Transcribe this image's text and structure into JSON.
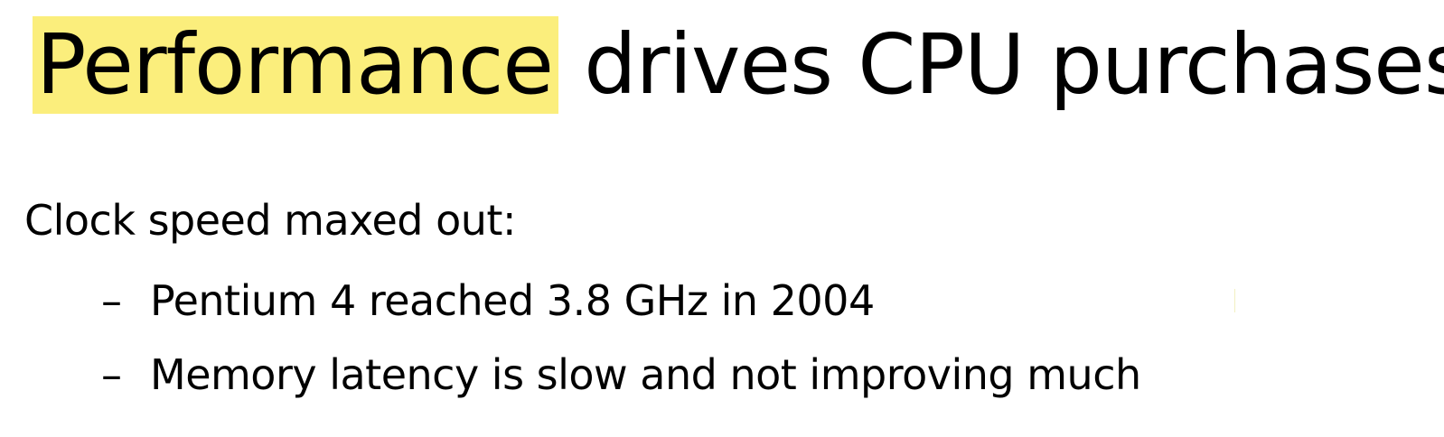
{
  "slide": {
    "title": {
      "highlighted": "Performance",
      "rest": " drives CPU purchases",
      "highlight_color": "#fbee7c"
    },
    "heading": "Clock speed maxed out:",
    "bullets": [
      {
        "marker": "–",
        "text": "Pentium 4 reached 3.8 GHz in 2004"
      },
      {
        "marker": "–",
        "text": "Memory latency is slow and not improving much"
      }
    ]
  }
}
